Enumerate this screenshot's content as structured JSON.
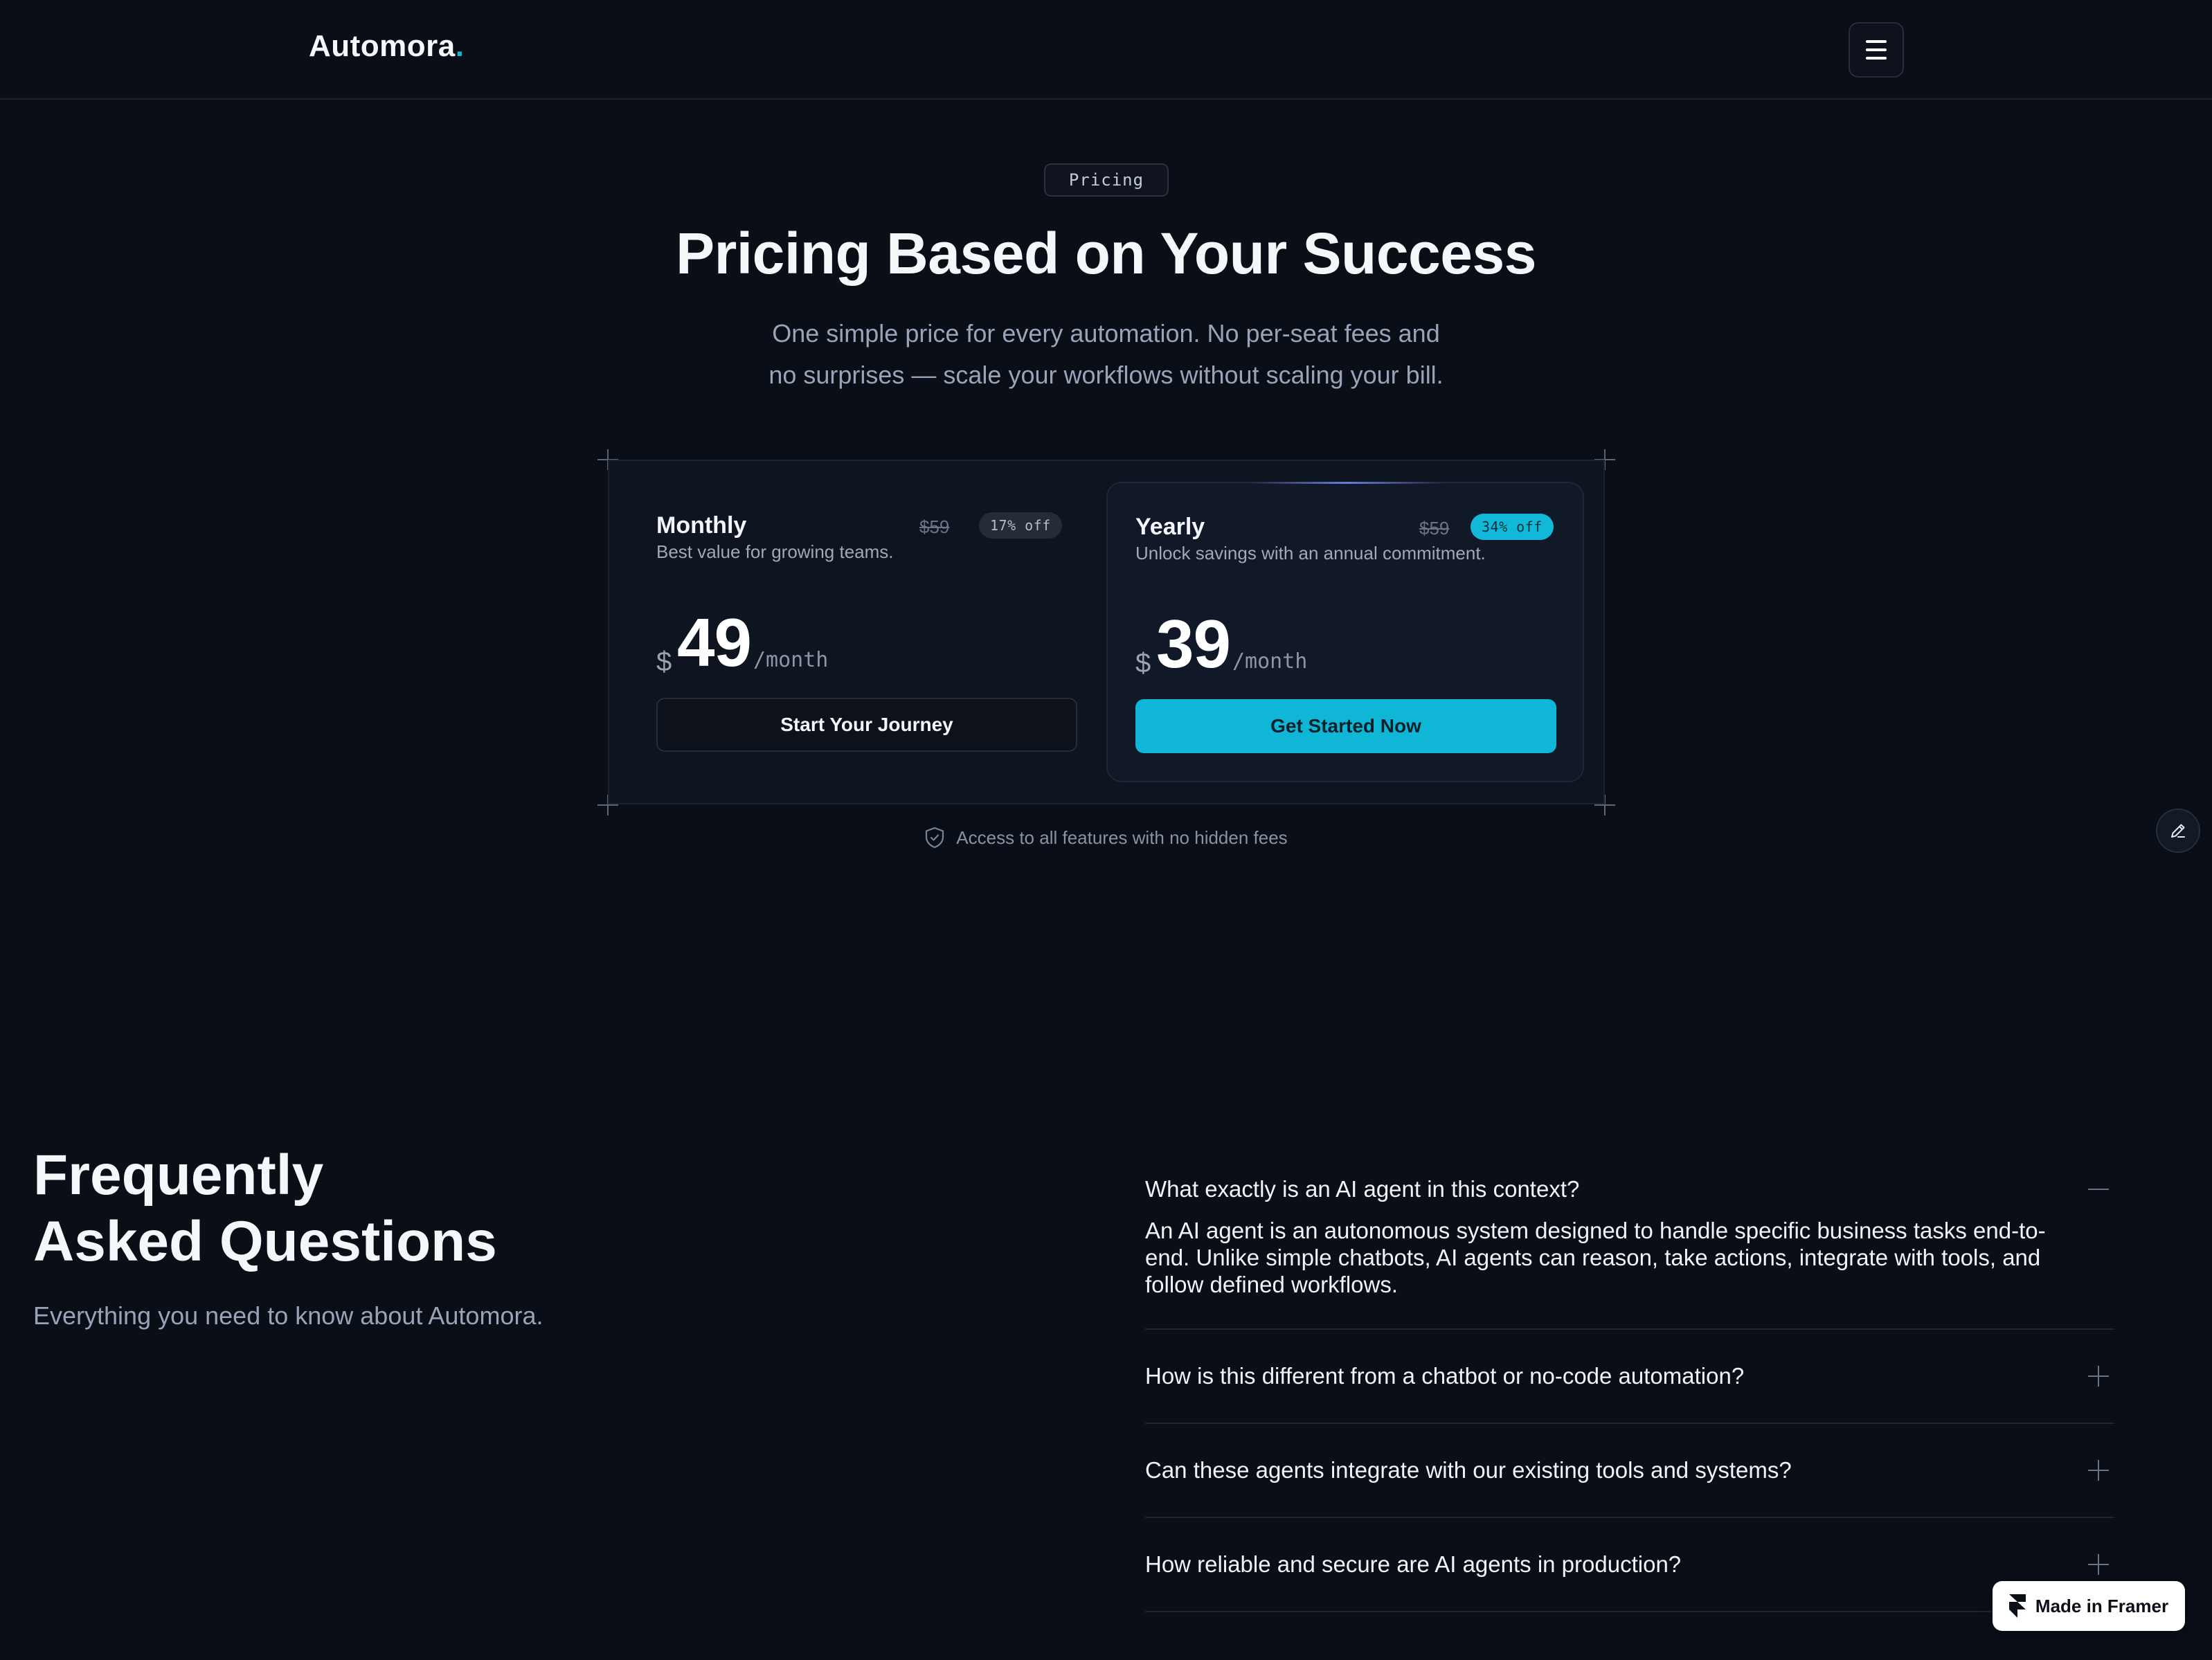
{
  "header": {
    "logo_text": "Automora",
    "logo_dot": ".",
    "menu_icon": "hamburger-menu-icon"
  },
  "pricing": {
    "tag": "Pricing",
    "headline": "Pricing Based on Your Success",
    "subtext_line1": "One simple price for every automation. No per-seat fees and",
    "subtext_line2": "no surprises — scale your workflows without scaling your bill.",
    "plans": [
      {
        "name": "Monthly",
        "description": "Best value for growing teams.",
        "old_price": "$59",
        "discount": "17% off",
        "currency": "$",
        "amount": "49",
        "period": "/month",
        "cta": "Start Your Journey"
      },
      {
        "name": "Yearly",
        "description": "Unlock savings with an annual commitment.",
        "old_price": "$59",
        "discount": "34% off",
        "currency": "$",
        "amount": "39",
        "period": "/month",
        "cta": "Get Started Now"
      }
    ],
    "assurance": "Access to all features with no hidden fees",
    "assurance_icon": "shield-check-icon"
  },
  "faq": {
    "title_line1": "Frequently",
    "title_line2": "Asked Questions",
    "subtitle": "Everything you need to know about Automora.",
    "items": [
      {
        "question": "What exactly is an AI agent in this context?",
        "answer": "An AI agent is an autonomous system designed to handle specific business tasks end-to-end. Unlike simple chatbots, AI agents can reason, take actions, integrate with tools, and follow defined workflows.",
        "expanded": true
      },
      {
        "question": "How is this different from a chatbot or no-code automation?",
        "expanded": false
      },
      {
        "question": "Can these agents integrate with our existing tools and systems?",
        "expanded": false
      },
      {
        "question": "How reliable and secure are AI agents in production?",
        "expanded": false
      }
    ]
  },
  "badge": {
    "label": "Made in Framer",
    "icon": "framer-logo-icon"
  },
  "colors": {
    "background": "#0a0e17",
    "accent": "#0fb6d6",
    "card": "#111827",
    "muted_text": "#9aa4b8"
  }
}
